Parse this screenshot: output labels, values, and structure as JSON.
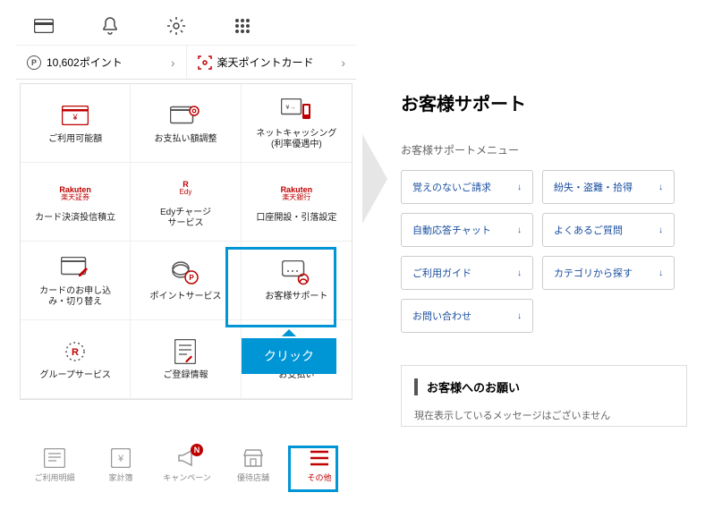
{
  "top": {
    "points_text": "10,602ポイント",
    "point_label": "P",
    "card_label": "楽天ポイントカード"
  },
  "grid": [
    {
      "label": "ご利用可能額",
      "icon": "card-yen"
    },
    {
      "label": "お支払い額調整",
      "icon": "card-gear"
    },
    {
      "label": "ネットキャッシング\n(利率優遇中)",
      "icon": "cashing"
    },
    {
      "label": "カード決済投信積立",
      "icon": "rakuten-sec",
      "logo_top": "Rakuten",
      "logo_bot": "楽天証券"
    },
    {
      "label": "Edyチャージ\nサービス",
      "icon": "edy",
      "logo_top": "R",
      "logo_bot": "Edy"
    },
    {
      "label": "口座開設・引落設定",
      "icon": "rakuten-bank",
      "logo_top": "Rakuten",
      "logo_bot": "楽天銀行"
    },
    {
      "label": "カードのお申し込\nみ・切り替え",
      "icon": "card-pen"
    },
    {
      "label": "ポイントサービス",
      "icon": "coin-p"
    },
    {
      "label": "お客様サポート",
      "icon": "support"
    },
    {
      "label": "グループサービス",
      "icon": "group-r"
    },
    {
      "label": "ご登録情報",
      "icon": "doc"
    },
    {
      "label": "お支払い",
      "icon": ""
    }
  ],
  "callout": "クリック",
  "nav": [
    {
      "label": "ご利用明細",
      "icon": "list"
    },
    {
      "label": "家計簿",
      "icon": "yen"
    },
    {
      "label": "キャンペーン",
      "icon": "mega",
      "badge": "N"
    },
    {
      "label": "優待店舗",
      "icon": "shop"
    },
    {
      "label": "その他",
      "icon": "menu",
      "active": true
    }
  ],
  "right": {
    "title": "お客様サポート",
    "subtitle": "お客様サポートメニュー",
    "buttons": [
      "覚えのないご請求",
      "紛失・盗難・拾得",
      "自動応答チャット",
      "よくあるご質問",
      "ご利用ガイド",
      "カテゴリから探す",
      "お問い合わせ"
    ],
    "notice_title": "お客様へのお願い",
    "notice_text": "現在表示しているメッセージはございません"
  }
}
